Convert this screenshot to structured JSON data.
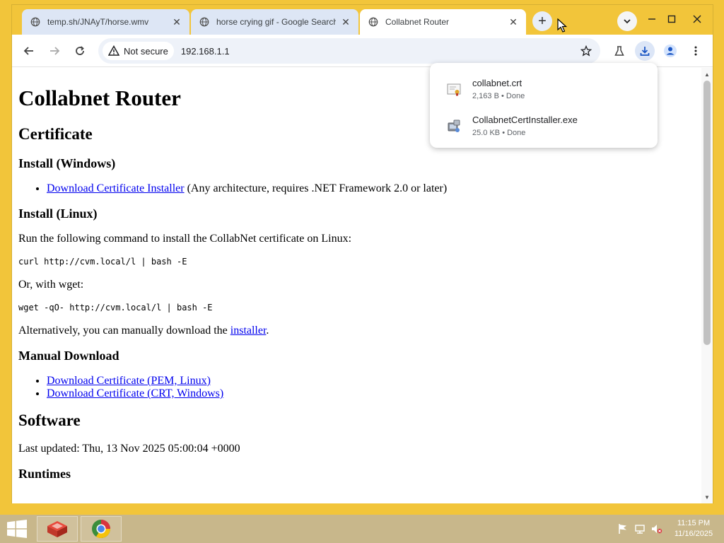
{
  "tabs": [
    {
      "title": "temp.sh/JNAyT/horse.wmv",
      "active": false
    },
    {
      "title": "horse crying gif - Google Search",
      "active": false
    },
    {
      "title": "Collabnet Router",
      "active": true
    }
  ],
  "toolbar": {
    "security_label": "Not secure",
    "url": "192.168.1.1"
  },
  "downloads": [
    {
      "name": "collabnet.crt",
      "status": "2,163 B • Done",
      "icon": "certificate-file-icon"
    },
    {
      "name": "CollabnetCertInstaller.exe",
      "status": "25.0 KB • Done",
      "icon": "executable-file-icon"
    }
  ],
  "page": {
    "title": "Collabnet Router",
    "certificate_heading": "Certificate",
    "install_windows_heading": "Install (Windows)",
    "windows_link": "Download Certificate Installer",
    "windows_note": " (Any architecture, requires .NET Framework 2.0 or later)",
    "install_linux_heading": "Install (Linux)",
    "linux_intro": "Run the following command to install the CollabNet certificate on Linux:",
    "curl_cmd": "curl http://cvm.local/l | bash -E",
    "wget_intro": "Or, with wget:",
    "wget_cmd": "wget -qO- http://cvm.local/l | bash -E",
    "alt_prefix": "Alternatively, you can manually download the ",
    "alt_link": "installer",
    "alt_suffix": ".",
    "manual_heading": "Manual Download",
    "manual_links": [
      "Download Certificate (PEM, Linux)",
      "Download Certificate (CRT, Windows)"
    ],
    "software_heading": "Software",
    "last_updated": "Last updated: Thu, 13 Nov 2025 05:00:04 +0000",
    "runtimes_heading": "Runtimes"
  },
  "taskbar": {
    "time": "11:15 PM",
    "date": "11/16/2025"
  },
  "colors": {
    "chrome_frame": "#f2c53a",
    "link": "#0000ee",
    "taskbar": "#c8b78b"
  }
}
